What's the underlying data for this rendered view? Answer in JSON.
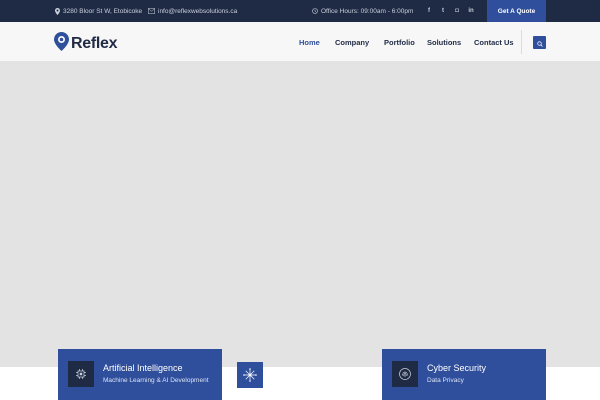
{
  "topbar": {
    "address": "3280 Bloor St W, Etobicoke",
    "email": "info@reflexwebsolutions.ca",
    "hours": "Office Hours: 09:00am - 6:00pm",
    "social": [
      {
        "icon": "facebook-icon",
        "glyph": "f"
      },
      {
        "icon": "twitter-icon",
        "glyph": "t"
      },
      {
        "icon": "instagram-icon",
        "glyph": "◘"
      },
      {
        "icon": "linkedin-icon",
        "glyph": "in"
      }
    ],
    "quote_label": "Get A Quote"
  },
  "header": {
    "logo_text": "Reflex",
    "nav": [
      {
        "label": "Home",
        "active": true
      },
      {
        "label": "Company",
        "active": false
      },
      {
        "label": "Portfolio",
        "active": false
      },
      {
        "label": "Solutions",
        "active": false
      },
      {
        "label": "Contact Us",
        "active": false
      }
    ],
    "search_icon": "search-icon"
  },
  "cards": [
    {
      "title": "Artificial Intelligence",
      "subtitle": "Machine Learning & AI Development",
      "icon": "ai-chip-icon"
    },
    {
      "title": "Cyber Security",
      "subtitle": "Data Privacy",
      "icon": "fingerprint-icon"
    }
  ],
  "middle_icon": "network-icon",
  "colors": {
    "topbar_bg": "#1f2a44",
    "accent": "#2f4f9c",
    "hero_bg": "#e3e3e3",
    "header_bg": "#f7f7f7"
  }
}
